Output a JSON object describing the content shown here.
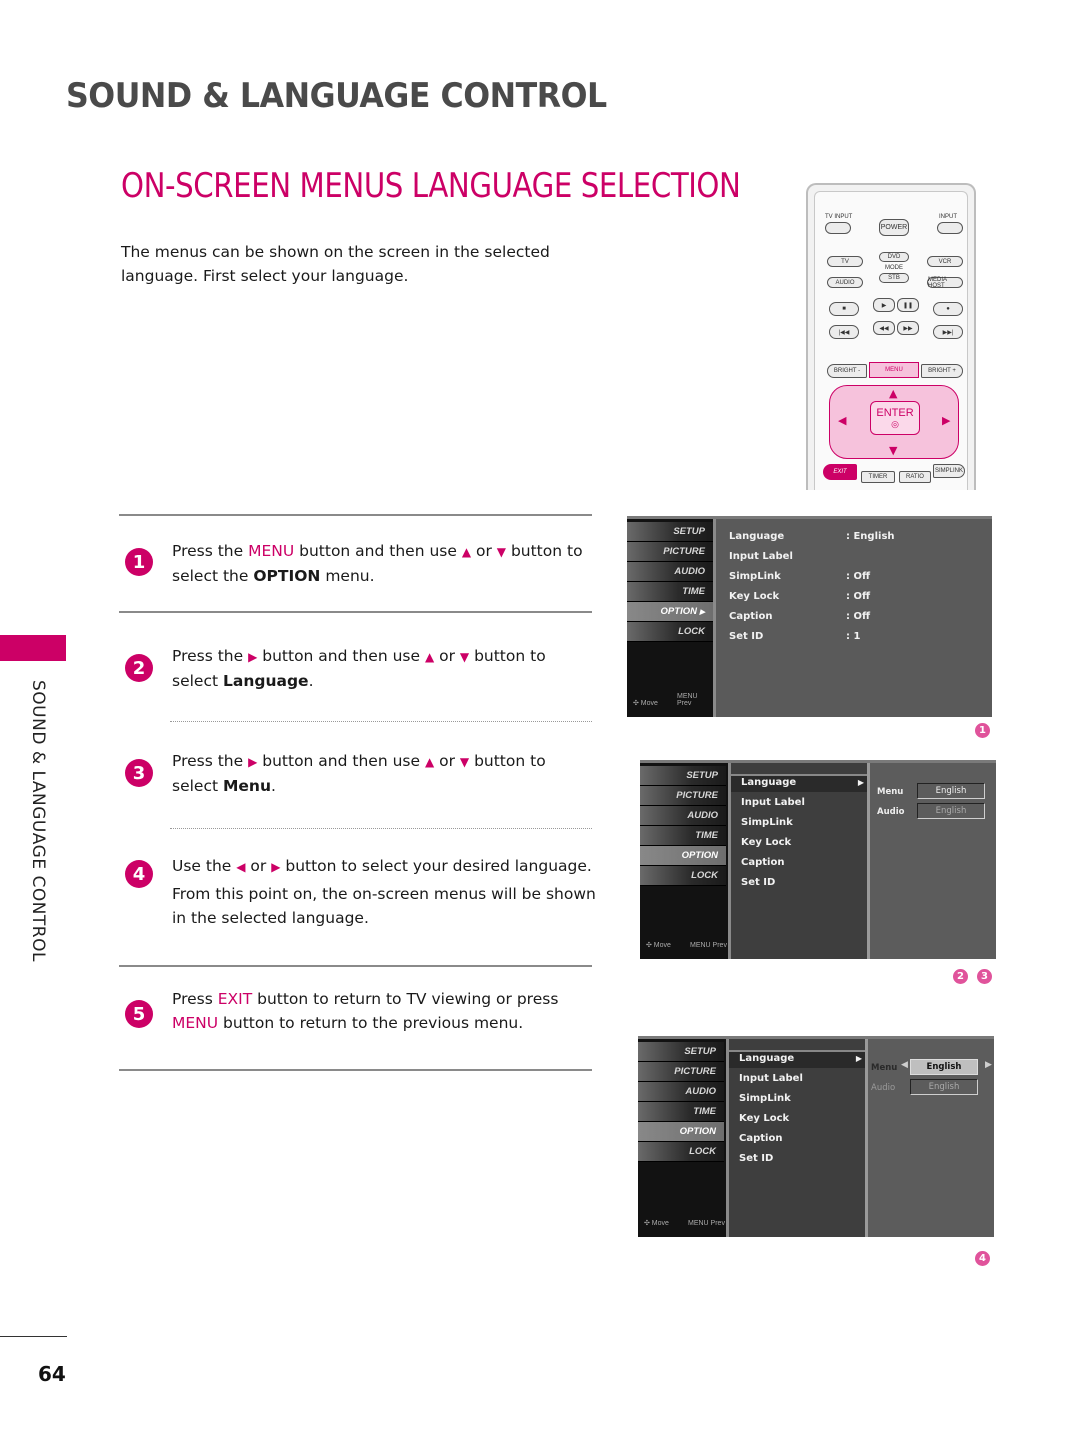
{
  "header": {
    "section_title": "SOUND & LANGUAGE CONTROL",
    "page_title": "ON-SCREEN MENUS LANGUAGE SELECTION",
    "intro": "The menus can be shown on the screen in the selected language. First select your language."
  },
  "side_tab": {
    "label": "SOUND & LANGUAGE CONTROL"
  },
  "page_number": "64",
  "colors": {
    "accent": "#cc0066",
    "heading": "#4a4a4a",
    "tv_bg": "#5a5a5a"
  },
  "steps": [
    {
      "num": "1",
      "parts": [
        "Press the ",
        "MENU",
        " button and then use ",
        "▲",
        " or ",
        "▼",
        " button to select the ",
        "OPTION",
        " menu."
      ]
    },
    {
      "num": "2",
      "parts": [
        "Press the ",
        "▶",
        " button and then use ",
        "▲",
        " or ",
        "▼",
        " button to select ",
        "Language",
        "."
      ]
    },
    {
      "num": "3",
      "parts": [
        "Press the ",
        "▶",
        " button and then use ",
        "▲",
        " or ",
        "▼",
        " button to select ",
        "Menu",
        "."
      ]
    },
    {
      "num": "4",
      "parts": [
        "Use the ",
        "◀",
        " or ",
        "▶",
        " button to select your desired language.",
        "From this point on, the on-screen menus will be shown in the selected language."
      ]
    },
    {
      "num": "5",
      "parts": [
        "Press ",
        "EXIT",
        " button to return to TV viewing or press ",
        "MENU",
        " button to return to the previous menu."
      ]
    }
  ],
  "remote": {
    "tv_input": "TV INPUT",
    "power": "POWER",
    "input": "INPUT",
    "tv": "TV",
    "dvd": "DVD",
    "vcr": "VCR",
    "mode": "MODE",
    "audio": "AUDIO",
    "stb": "STB",
    "media_host": "MEDIA HOST",
    "stop": "■",
    "play": "▶",
    "pause": "❚❚",
    "rec": "●",
    "prev": "|◀◀",
    "rew": "◀◀",
    "ff": "▶▶",
    "next": "▶▶|",
    "bright_minus": "BRIGHT -",
    "menu": "MENU",
    "bright_plus": "BRIGHT +",
    "enter": "ENTER",
    "enter_dot": "◎",
    "up": "▲",
    "down": "▼",
    "left": "◀",
    "right": "▶",
    "exit": "EXIT",
    "timer": "TIMER",
    "ratio": "RATIO",
    "simplink": "SIMPLINK"
  },
  "tv_menu": {
    "categories": [
      "SETUP",
      "PICTURE",
      "AUDIO",
      "TIME",
      "OPTION",
      "LOCK"
    ],
    "active_category": "OPTION",
    "footer_move": "✣ Move",
    "footer_prev": "MENU Prev",
    "option_items": [
      {
        "label": "Language",
        "value": ": English"
      },
      {
        "label": "Input Label",
        "value": ""
      },
      {
        "label": "SimpLink",
        "value": ": Off"
      },
      {
        "label": "Key Lock",
        "value": ": Off"
      },
      {
        "label": "Caption",
        "value": ": Off"
      },
      {
        "label": "Set ID",
        "value": ": 1"
      }
    ],
    "submenu_arrow": "▶",
    "language_rows": [
      {
        "label": "Menu",
        "value": "English"
      },
      {
        "label": "Audio",
        "value": "English"
      }
    ],
    "left_arrow": "◀",
    "right_arrow": "▶"
  },
  "screen_badges": {
    "screen1": [
      "1"
    ],
    "screen2": [
      "2",
      "3"
    ],
    "screen3": [
      "4"
    ]
  }
}
